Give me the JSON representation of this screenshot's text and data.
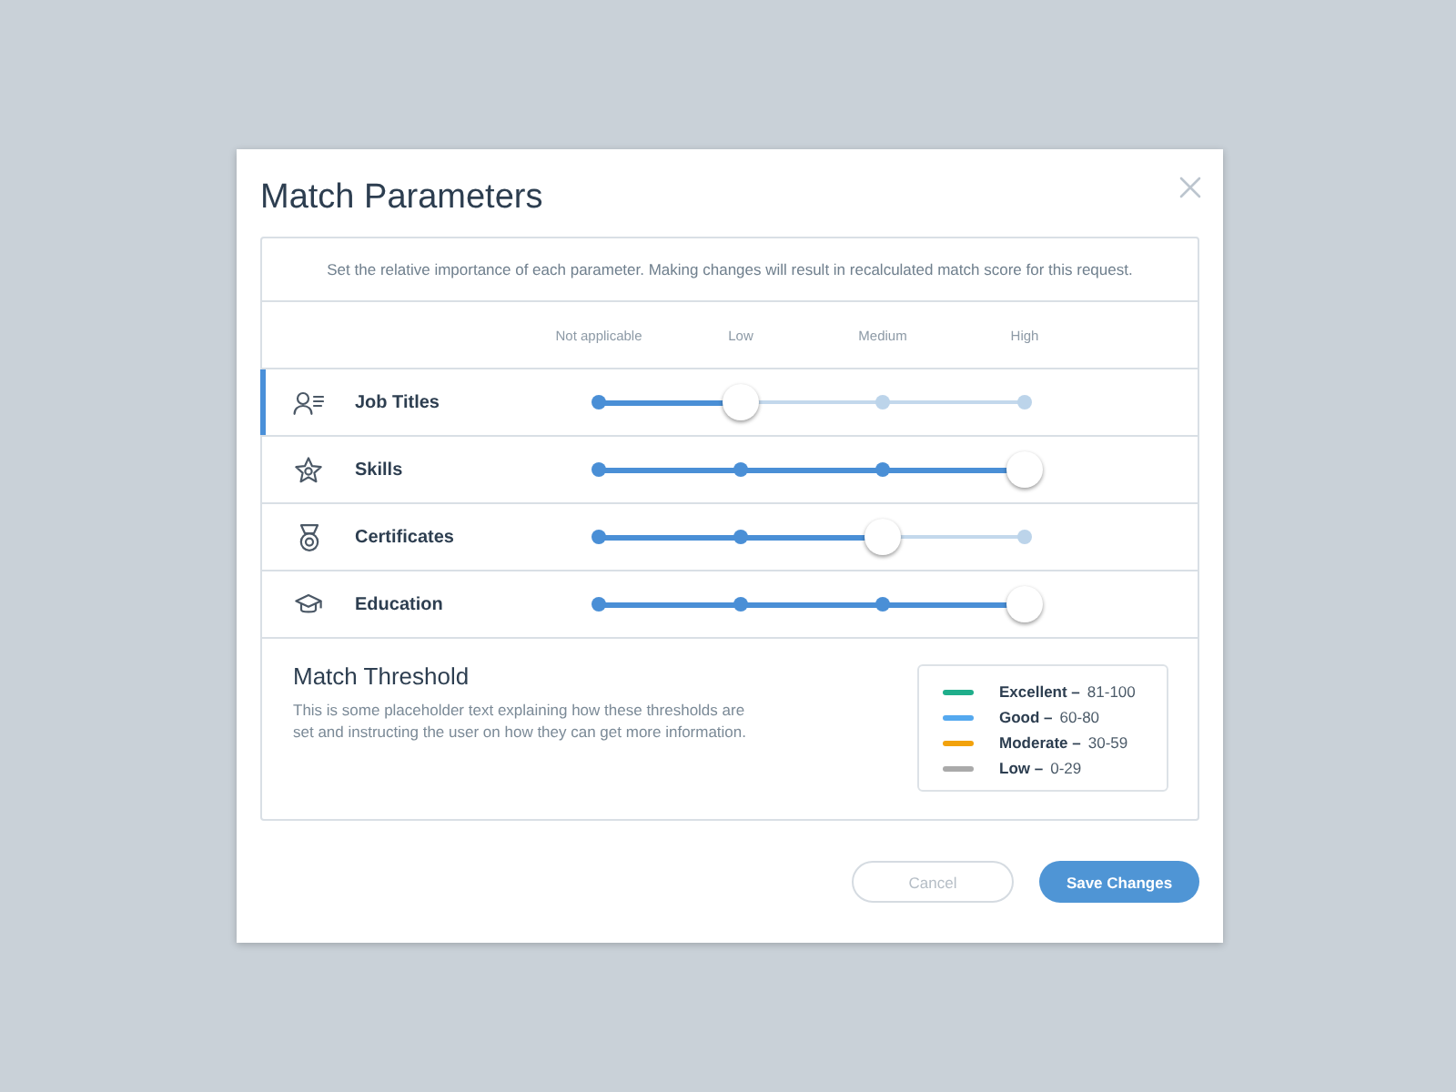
{
  "dialog": {
    "title": "Match Parameters"
  },
  "description": "Set the relative importance of each parameter. Making changes will result in recalculated match score for this request.",
  "scale_labels": [
    "Not applicable",
    "Low",
    "Medium",
    "High"
  ],
  "parameters": [
    {
      "name": "Job Titles",
      "selected": true,
      "level": 0.333
    },
    {
      "name": "Skills",
      "selected": false,
      "level": 1
    },
    {
      "name": "Certificates",
      "selected": false,
      "level": 0.667
    },
    {
      "name": "Education",
      "selected": false,
      "level": 1
    }
  ],
  "threshold": {
    "title": "Match Threshold",
    "text": "This is some placeholder text explaining how these thresholds are set and instructing the user on how they can get more information.",
    "legend": [
      {
        "label": "Excellent –",
        "range": "81-100",
        "color": "#1fae8b"
      },
      {
        "label": "Good –",
        "range": "60-80",
        "color": "#55a9ef"
      },
      {
        "label": "Moderate –",
        "range": "30-59",
        "color": "#f2a20c"
      },
      {
        "label": "Low –",
        "range": "0-29",
        "color": "#aaaaaa"
      }
    ]
  },
  "buttons": [
    {
      "label": "Cancel",
      "kind": "secondary"
    },
    {
      "label": "Save Changes",
      "kind": "primary"
    }
  ]
}
